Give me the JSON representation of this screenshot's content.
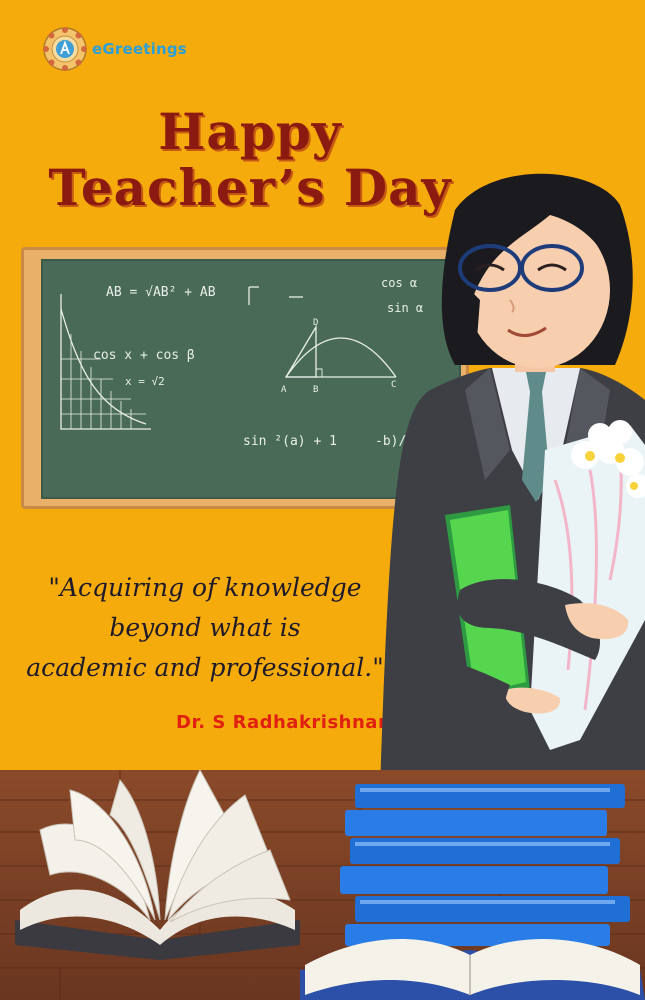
{
  "logo": {
    "text": "eGreetings"
  },
  "title": {
    "line1": "Happy",
    "line2": "Teacher’s Day"
  },
  "quote": {
    "line1": "\"Acquiring of knowledge",
    "line2": "beyond what is",
    "line3": "academic and professional.\""
  },
  "author": "Dr. S Radhakrishnan",
  "chalkboard": {
    "formula1": "AB = √AB² + AB",
    "formula2": "cos α",
    "formula3": "sin α",
    "formula4": "cos x + cos β",
    "formula5": "x = √2",
    "formula6": "sin ²(a) + 1",
    "formula7": "-b)/2",
    "point_a": "A",
    "point_b": "B",
    "point_c": "C",
    "point_d": "D"
  },
  "colors": {
    "background": "#f6ab0d",
    "title": "#8b1a10",
    "board": "#4a6a58",
    "author": "#e02010",
    "logo": "#2a9fd8"
  }
}
